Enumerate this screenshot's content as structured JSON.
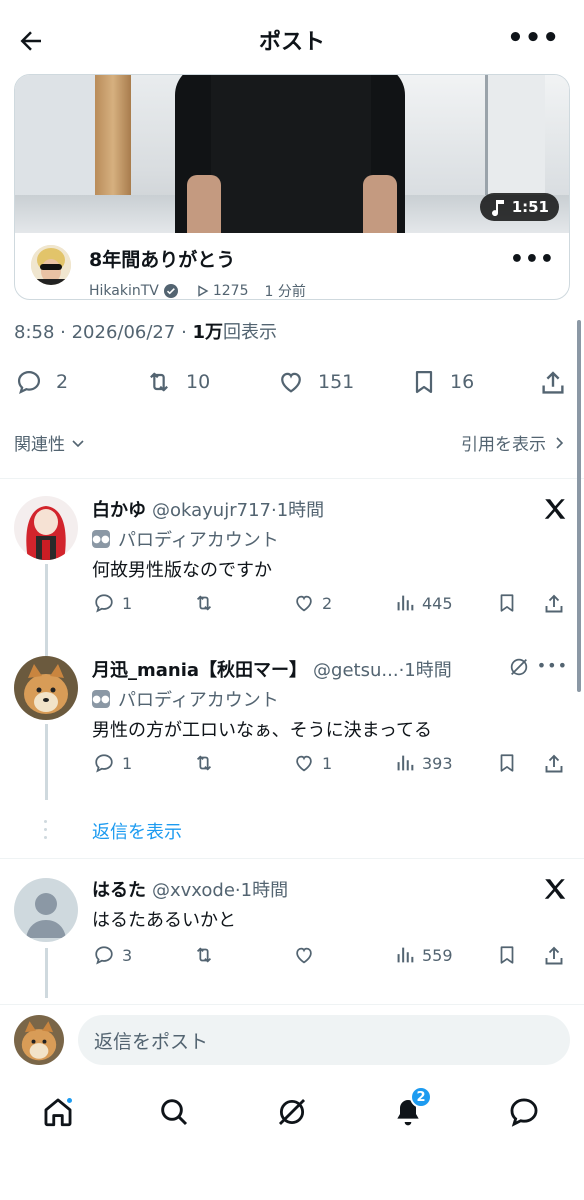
{
  "header": {
    "title": "ポスト"
  },
  "video_card": {
    "duration": "1:51",
    "title": "8年間ありがとう",
    "channel": "HikakinTV",
    "views": "1275",
    "time_ago": "1 分前"
  },
  "post_meta": {
    "time": "8:58",
    "date": "2026/06/27",
    "views_count": "1万",
    "views_suffix": "回表示"
  },
  "stats": {
    "replies": "2",
    "reposts": "10",
    "likes": "151",
    "bookmarks": "16"
  },
  "sort": {
    "label": "関連性"
  },
  "quotes": {
    "label": "引用を表示"
  },
  "replies": [
    {
      "name": "白かゆ",
      "handle": "@okayujr717",
      "time": "·1時間",
      "parody": "パロディアカウント",
      "text": "何故男性版なのですか",
      "counts": {
        "reply": "1",
        "repost": "",
        "like": "2",
        "views": "445"
      }
    },
    {
      "name": "月迅_mania【秋田マー】",
      "handle": "@getsu...",
      "time": "·1時間",
      "parody": "パロディアカウント",
      "text": "男性の方が工ロいなぁ、そうに決まってる",
      "counts": {
        "reply": "1",
        "repost": "",
        "like": "1",
        "views": "393"
      }
    },
    {
      "name": "はるた",
      "handle": "@xvxode",
      "time": "·1時間",
      "text": "はるたあるいかと",
      "counts": {
        "reply": "3",
        "repost": "",
        "like": "",
        "views": "559"
      }
    }
  ],
  "show_replies": "返信を表示",
  "composer": {
    "placeholder": "返信をポスト"
  },
  "tabbar": {
    "notifications_count": "2"
  },
  "colors": {
    "accent": "#1d9bf0",
    "text": "#0f1419",
    "muted": "#536471",
    "border": "#cfd9de"
  }
}
